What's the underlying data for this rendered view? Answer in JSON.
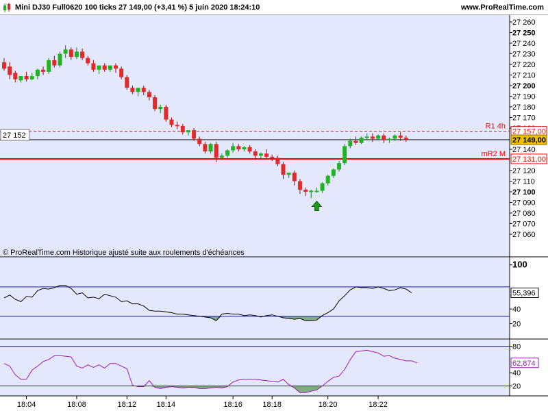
{
  "header": {
    "title": "Mini DJ30 Full0620 100 ticks 27 149,00 (+3,41 %) 5 juin 2020 18:24:10",
    "site": "www.ProRealTime.com"
  },
  "main_panel": {
    "watermark": "© ProRealTime.com  Historique ajusté suite aux roulements d'échéances",
    "cursor_value": "27 152",
    "y_ticks": [
      {
        "value": 27260,
        "label": "27 260",
        "bold": false
      },
      {
        "value": 27250,
        "label": "27 250",
        "bold": true
      },
      {
        "value": 27240,
        "label": "27 240",
        "bold": false
      },
      {
        "value": 27230,
        "label": "27 230",
        "bold": false
      },
      {
        "value": 27220,
        "label": "27 220",
        "bold": false
      },
      {
        "value": 27210,
        "label": "27 210",
        "bold": false
      },
      {
        "value": 27200,
        "label": "27 200",
        "bold": true
      },
      {
        "value": 27190,
        "label": "27 190",
        "bold": false
      },
      {
        "value": 27180,
        "label": "27 180",
        "bold": false
      },
      {
        "value": 27170,
        "label": "27 170",
        "bold": false
      },
      {
        "value": 27160,
        "label": "27 160",
        "bold": false
      },
      {
        "value": 27140,
        "label": "27 140",
        "bold": false
      },
      {
        "value": 27120,
        "label": "27 120",
        "bold": false
      },
      {
        "value": 27110,
        "label": "27 110",
        "bold": false
      },
      {
        "value": 27100,
        "label": "27 100",
        "bold": true
      },
      {
        "value": 27090,
        "label": "27 090",
        "bold": false
      },
      {
        "value": 27080,
        "label": "27 080",
        "bold": false
      },
      {
        "value": 27070,
        "label": "27 070",
        "bold": false
      },
      {
        "value": 27060,
        "label": "27 060",
        "bold": false
      }
    ],
    "levels": {
      "r1": {
        "name": "R1 4h",
        "value": 27157.0,
        "label": "27 157,00",
        "color": "#e01010"
      },
      "mr2": {
        "name": "mR2 M",
        "value": 27131.0,
        "label": "27 131,00",
        "color": "#ff0000"
      },
      "price": {
        "value": 27149.0,
        "label": "27 149,00",
        "color": "#f0c000"
      }
    }
  },
  "x_axis": {
    "labels": [
      {
        "label": "18:04",
        "bar": 4
      },
      {
        "label": "18:08",
        "bar": 13
      },
      {
        "label": "18:12",
        "bar": 22
      },
      {
        "label": "18:14",
        "bar": 29
      },
      {
        "label": "18:16",
        "bar": 41
      },
      {
        "label": "18:18",
        "bar": 48
      },
      {
        "label": "18:20",
        "bar": 58
      },
      {
        "label": "18:22",
        "bar": 67
      }
    ]
  },
  "indicator1": {
    "value_label": "55,396",
    "y_ticks": [
      {
        "value": 100,
        "label": "100",
        "bold": true
      },
      {
        "value": 40,
        "label": "40",
        "bold": false
      },
      {
        "value": 20,
        "label": "20",
        "bold": false
      }
    ]
  },
  "indicator2": {
    "value_label": "62,874",
    "y_ticks": [
      {
        "value": 80,
        "label": "80",
        "bold": false
      },
      {
        "value": 40,
        "label": "40",
        "bold": false
      },
      {
        "value": 20,
        "label": "20",
        "bold": false
      }
    ]
  },
  "colors": {
    "background": "#e4e8fc",
    "up": "#22b322",
    "down": "#e12a2a",
    "line1": "#000000",
    "line2": "#9a1ab8",
    "band": "#1a1aa0",
    "fill_low": "#6fa06f",
    "arrow": "#1f9a1f"
  },
  "chart_data": [
    {
      "type": "candlestick",
      "title": "Mini DJ30 Full0620 100 ticks",
      "ylim": [
        27052,
        27266
      ],
      "candles": [
        {
          "o": 27222,
          "h": 27226,
          "c": 27216,
          "l": 27214
        },
        {
          "o": 27218,
          "h": 27222,
          "c": 27210,
          "l": 27206
        },
        {
          "o": 27212,
          "h": 27214,
          "c": 27206,
          "l": 27203
        },
        {
          "o": 27205,
          "h": 27208,
          "c": 27209,
          "l": 27203
        },
        {
          "o": 27209,
          "h": 27213,
          "c": 27206,
          "l": 27204
        },
        {
          "o": 27206,
          "h": 27212,
          "c": 27209,
          "l": 27205
        },
        {
          "o": 27209,
          "h": 27216,
          "c": 27215,
          "l": 27206
        },
        {
          "o": 27215,
          "h": 27218,
          "c": 27213,
          "l": 27210
        },
        {
          "o": 27213,
          "h": 27226,
          "c": 27224,
          "l": 27211
        },
        {
          "o": 27224,
          "h": 27228,
          "c": 27219,
          "l": 27217
        },
        {
          "o": 27219,
          "h": 27232,
          "c": 27230,
          "l": 27217
        },
        {
          "o": 27230,
          "h": 27238,
          "c": 27234,
          "l": 27226
        },
        {
          "o": 27234,
          "h": 27236,
          "c": 27227,
          "l": 27224
        },
        {
          "o": 27227,
          "h": 27236,
          "c": 27232,
          "l": 27225
        },
        {
          "o": 27232,
          "h": 27235,
          "c": 27226,
          "l": 27224
        },
        {
          "o": 27226,
          "h": 27228,
          "c": 27221,
          "l": 27219
        },
        {
          "o": 27221,
          "h": 27224,
          "c": 27215,
          "l": 27213
        },
        {
          "o": 27215,
          "h": 27217,
          "c": 27219,
          "l": 27211
        },
        {
          "o": 27219,
          "h": 27221,
          "c": 27215,
          "l": 27213
        },
        {
          "o": 27215,
          "h": 27217,
          "c": 27219,
          "l": 27213
        },
        {
          "o": 27219,
          "h": 27221,
          "c": 27216,
          "l": 27212
        },
        {
          "o": 27216,
          "h": 27218,
          "c": 27208,
          "l": 27206
        },
        {
          "o": 27208,
          "h": 27210,
          "c": 27198,
          "l": 27196
        },
        {
          "o": 27198,
          "h": 27200,
          "c": 27194,
          "l": 27192
        },
        {
          "o": 27194,
          "h": 27196,
          "c": 27198,
          "l": 27190
        },
        {
          "o": 27198,
          "h": 27200,
          "c": 27194,
          "l": 27191
        },
        {
          "o": 27194,
          "h": 27196,
          "c": 27189,
          "l": 27186
        },
        {
          "o": 27189,
          "h": 27191,
          "c": 27178,
          "l": 27176
        },
        {
          "o": 27178,
          "h": 27182,
          "c": 27180,
          "l": 27174
        },
        {
          "o": 27180,
          "h": 27182,
          "c": 27168,
          "l": 27166
        },
        {
          "o": 27168,
          "h": 27170,
          "c": 27163,
          "l": 27161
        },
        {
          "o": 27163,
          "h": 27166,
          "c": 27162,
          "l": 27159
        },
        {
          "o": 27162,
          "h": 27164,
          "c": 27156,
          "l": 27154
        },
        {
          "o": 27156,
          "h": 27158,
          "c": 27158,
          "l": 27153
        },
        {
          "o": 27158,
          "h": 27160,
          "c": 27150,
          "l": 27148
        },
        {
          "o": 27150,
          "h": 27152,
          "c": 27145,
          "l": 27143
        },
        {
          "o": 27145,
          "h": 27147,
          "c": 27138,
          "l": 27136
        },
        {
          "o": 27138,
          "h": 27146,
          "c": 27145,
          "l": 27136
        },
        {
          "o": 27145,
          "h": 27147,
          "c": 27132,
          "l": 27128
        },
        {
          "o": 27132,
          "h": 27136,
          "c": 27134,
          "l": 27130
        },
        {
          "o": 27134,
          "h": 27140,
          "c": 27139,
          "l": 27132
        },
        {
          "o": 27139,
          "h": 27146,
          "c": 27143,
          "l": 27137
        },
        {
          "o": 27143,
          "h": 27145,
          "c": 27140,
          "l": 27138
        },
        {
          "o": 27140,
          "h": 27143,
          "c": 27142,
          "l": 27138
        },
        {
          "o": 27142,
          "h": 27144,
          "c": 27138,
          "l": 27136
        },
        {
          "o": 27138,
          "h": 27140,
          "c": 27134,
          "l": 27130
        },
        {
          "o": 27134,
          "h": 27137,
          "c": 27136,
          "l": 27131
        },
        {
          "o": 27136,
          "h": 27140,
          "c": 27133,
          "l": 27131
        },
        {
          "o": 27133,
          "h": 27135,
          "c": 27132,
          "l": 27129
        },
        {
          "o": 27132,
          "h": 27134,
          "c": 27126,
          "l": 27124
        },
        {
          "o": 27126,
          "h": 27128,
          "c": 27116,
          "l": 27112
        },
        {
          "o": 27116,
          "h": 27118,
          "c": 27118,
          "l": 27113
        },
        {
          "o": 27118,
          "h": 27120,
          "c": 27110,
          "l": 27106
        },
        {
          "o": 27110,
          "h": 27112,
          "c": 27102,
          "l": 27098
        },
        {
          "o": 27102,
          "h": 27104,
          "c": 27100,
          "l": 27096
        },
        {
          "o": 27100,
          "h": 27102,
          "c": 27101,
          "l": 27094
        },
        {
          "o": 27101,
          "h": 27104,
          "c": 27101,
          "l": 27099
        },
        {
          "o": 27101,
          "h": 27109,
          "c": 27108,
          "l": 27099
        },
        {
          "o": 27108,
          "h": 27116,
          "c": 27115,
          "l": 27106
        },
        {
          "o": 27115,
          "h": 27122,
          "c": 27121,
          "l": 27113
        },
        {
          "o": 27121,
          "h": 27129,
          "c": 27127,
          "l": 27119
        },
        {
          "o": 27127,
          "h": 27145,
          "c": 27143,
          "l": 27125
        },
        {
          "o": 27143,
          "h": 27150,
          "c": 27148,
          "l": 27141
        },
        {
          "o": 27148,
          "h": 27152,
          "c": 27146,
          "l": 27144
        },
        {
          "o": 27146,
          "h": 27152,
          "c": 27151,
          "l": 27145
        },
        {
          "o": 27151,
          "h": 27155,
          "c": 27152,
          "l": 27149
        },
        {
          "o": 27152,
          "h": 27155,
          "c": 27150,
          "l": 27147
        },
        {
          "o": 27150,
          "h": 27154,
          "c": 27153,
          "l": 27149
        },
        {
          "o": 27153,
          "h": 27155,
          "c": 27149,
          "l": 27146
        },
        {
          "o": 27149,
          "h": 27151,
          "c": 27150,
          "l": 27146
        },
        {
          "o": 27150,
          "h": 27154,
          "c": 27153,
          "l": 27148
        },
        {
          "o": 27153,
          "h": 27156,
          "c": 27151,
          "l": 27148
        },
        {
          "o": 27151,
          "h": 27153,
          "c": 27149,
          "l": 27147
        }
      ],
      "up_arrow_bar": 56
    },
    {
      "type": "line",
      "name": "indicator1",
      "ylim": [
        0,
        110
      ],
      "bands": [
        70,
        30
      ],
      "values": [
        55,
        59,
        53,
        50,
        57,
        56,
        65,
        68,
        67,
        69,
        72,
        72,
        68,
        60,
        62,
        55,
        56,
        54,
        60,
        58,
        56,
        50,
        51,
        47,
        47,
        44,
        38,
        37,
        37,
        36,
        35,
        33,
        33,
        32,
        31,
        30,
        29,
        28,
        24,
        33,
        34,
        33,
        33,
        31,
        32,
        31,
        29,
        31,
        32,
        30,
        28,
        27,
        26,
        27,
        24,
        24,
        25,
        31,
        35,
        40,
        51,
        58,
        66,
        70,
        69,
        69,
        68,
        70,
        68,
        65,
        66,
        69,
        67,
        62
      ]
    },
    {
      "type": "line",
      "name": "indicator2",
      "ylim": [
        5,
        90
      ],
      "bands": [
        80,
        20
      ],
      "values": [
        54,
        50,
        37,
        30,
        30,
        44,
        50,
        57,
        60,
        66,
        66,
        65,
        64,
        50,
        47,
        52,
        48,
        52,
        47,
        54,
        54,
        50,
        46,
        21,
        19,
        19,
        28,
        18,
        16,
        18,
        19,
        18,
        17,
        18,
        18,
        16,
        16,
        17,
        18,
        17,
        19,
        26,
        29,
        30,
        30,
        30,
        29,
        28,
        27,
        26,
        30,
        22,
        17,
        10,
        10,
        12,
        14,
        20,
        27,
        33,
        35,
        45,
        60,
        72,
        73,
        74,
        72,
        70,
        65,
        66,
        62,
        60,
        58,
        58,
        55
      ]
    }
  ]
}
